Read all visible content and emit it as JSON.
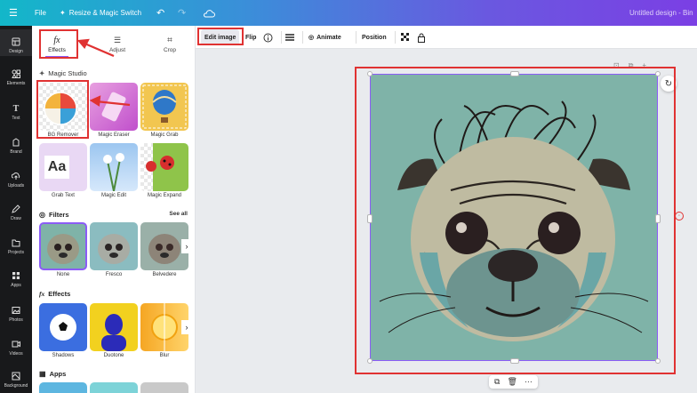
{
  "topbar": {
    "menu_icon": "hamburger-icon",
    "file": "File",
    "resize": "Resize & Magic Switch",
    "doc_title": "Untitled design - Bin"
  },
  "rail": {
    "items": [
      {
        "label": "Design",
        "icon": "design-icon"
      },
      {
        "label": "Elements",
        "icon": "elements-icon"
      },
      {
        "label": "Text",
        "icon": "text-icon"
      },
      {
        "label": "Brand",
        "icon": "brand-icon"
      },
      {
        "label": "Uploads",
        "icon": "upload-icon"
      },
      {
        "label": "Draw",
        "icon": "draw-icon"
      },
      {
        "label": "Projects",
        "icon": "folder-icon"
      },
      {
        "label": "Apps",
        "icon": "apps-icon"
      },
      {
        "label": "Photos",
        "icon": "photos-icon"
      },
      {
        "label": "Videos",
        "icon": "videos-icon"
      },
      {
        "label": "Background",
        "icon": "background-icon"
      }
    ]
  },
  "panel": {
    "tabs": [
      {
        "label": "Effects",
        "glyph": "fx"
      },
      {
        "label": "Adjust",
        "glyph": "☰"
      },
      {
        "label": "Crop",
        "glyph": "⌗"
      }
    ],
    "magic_studio": {
      "title": "Magic Studio",
      "tools": [
        "BG Remover",
        "Magic Eraser",
        "Magic Grab",
        "Grab Text",
        "Magic Edit",
        "Magic Expand"
      ]
    },
    "filters": {
      "title": "Filters",
      "see_all": "See all",
      "items": [
        "None",
        "Fresco",
        "Belvedere"
      ]
    },
    "effects": {
      "title": "Effects",
      "items": [
        "Shadows",
        "Duotone",
        "Blur"
      ]
    },
    "apps": {
      "title": "Apps"
    },
    "grab_text_glyph": "Aa"
  },
  "toolbar": {
    "edit_image": "Edit image",
    "flip": "Flip",
    "animate": "Animate",
    "position": "Position"
  },
  "colors": {
    "highlight": "#e03232",
    "selection": "#8b5cf6",
    "canvas_bg": "#7fb3a8"
  }
}
